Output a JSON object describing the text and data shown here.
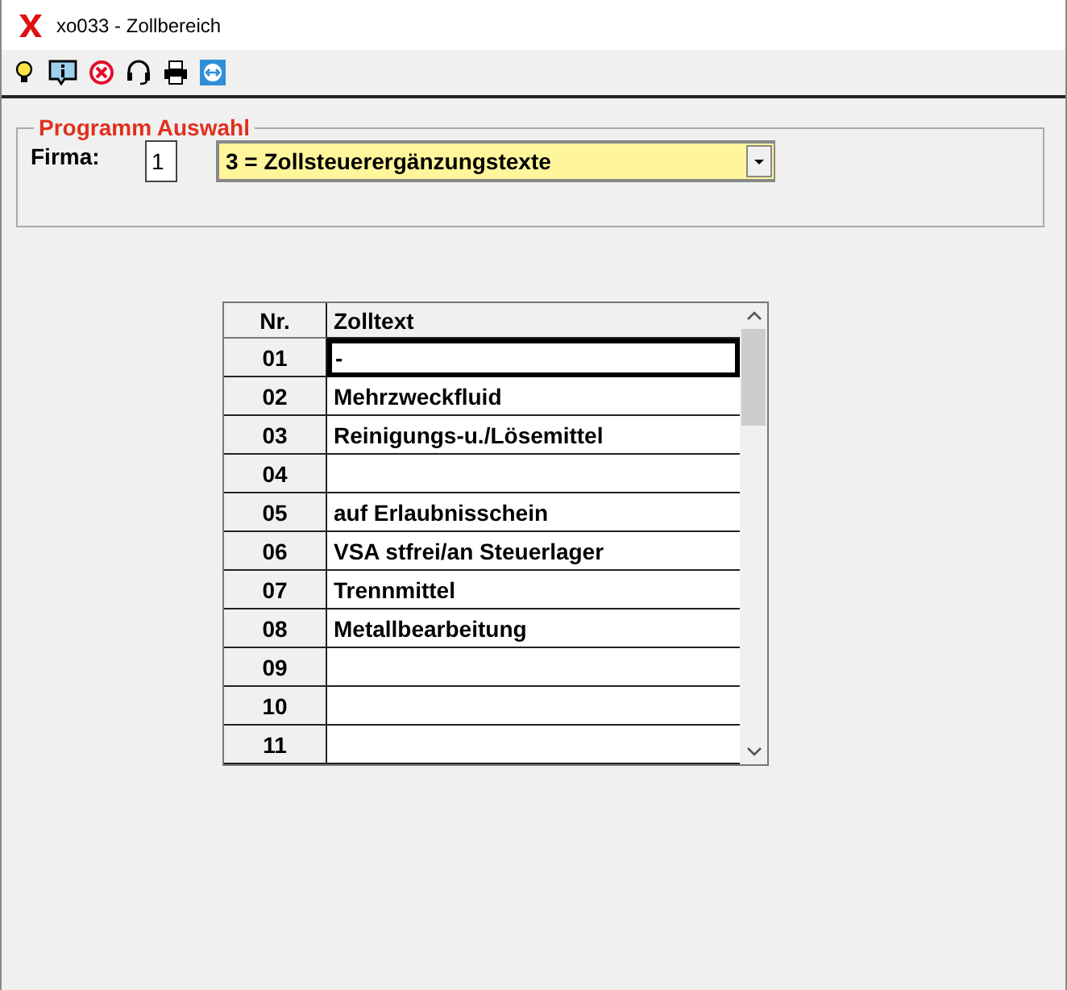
{
  "window": {
    "title": "xo033 - Zollbereich"
  },
  "group": {
    "title": "Programm Auswahl",
    "firma_label": "Firma:",
    "firma_value": "1",
    "selection": "3 = Zollsteuerergänzungstexte"
  },
  "table": {
    "columns": [
      "Nr.",
      "Zolltext"
    ],
    "rows": [
      {
        "nr": "01",
        "text": "-",
        "selected": true
      },
      {
        "nr": "02",
        "text": "Mehrzweckfluid",
        "selected": false
      },
      {
        "nr": "03",
        "text": "Reinigungs-u./Lösemittel",
        "selected": false
      },
      {
        "nr": "04",
        "selected": false
      },
      {
        "nr": "05",
        "text": "auf Erlaubnisschein",
        "selected": false
      },
      {
        "nr": "06",
        "text": "VSA stfrei/an Steuerlager",
        "selected": false
      },
      {
        "nr": "07",
        "text": "Trennmittel",
        "selected": false
      },
      {
        "nr": "08",
        "text": "Metallbearbeitung",
        "selected": false
      },
      {
        "nr": "09",
        "selected": false
      },
      {
        "nr": "10",
        "selected": false
      },
      {
        "nr": "11",
        "selected": false
      }
    ]
  }
}
